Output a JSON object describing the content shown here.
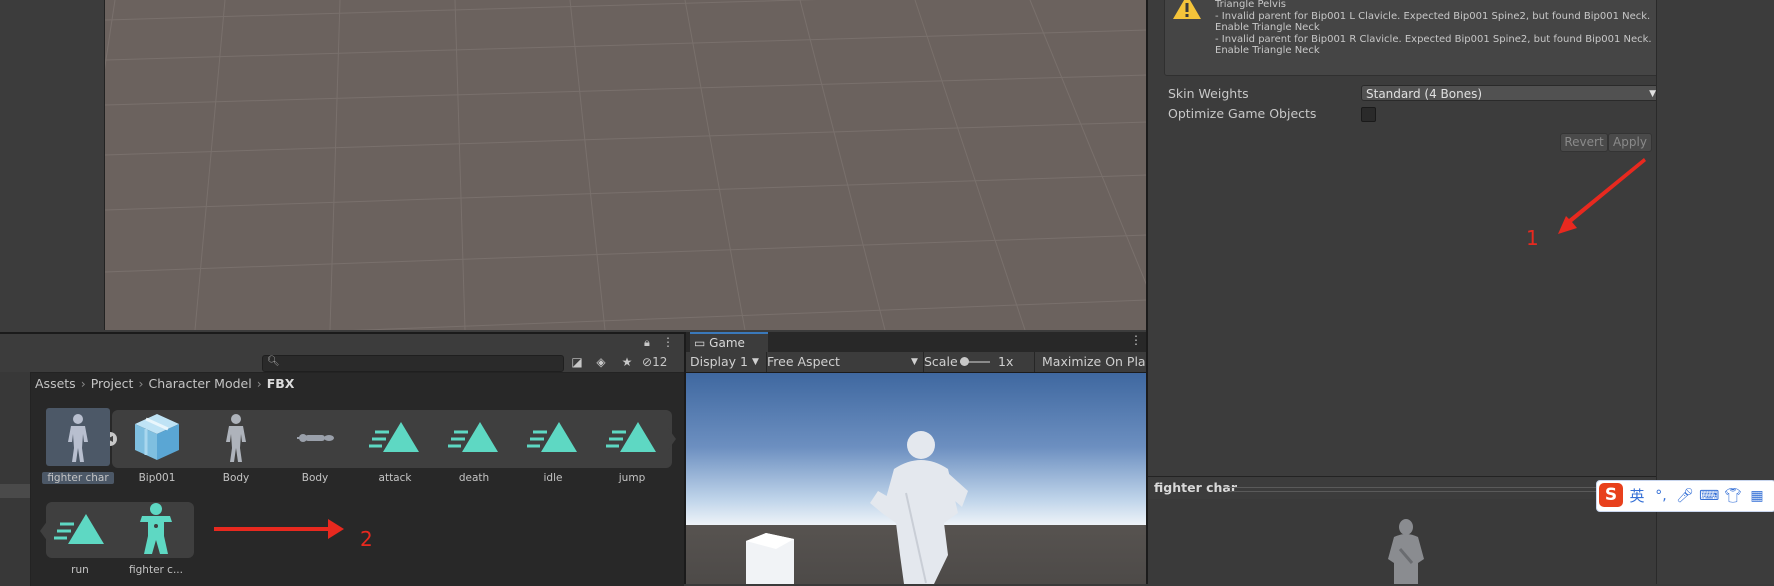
{
  "scene": {},
  "project": {
    "search_placeholder": "",
    "search_icon": "search-icon",
    "hidden_count": "12",
    "breadcrumb": [
      "Assets",
      "Project",
      "Character Model",
      "FBX"
    ],
    "assets_row1": [
      {
        "label": "fighter char",
        "icon": "character-model-icon",
        "selected": true
      },
      {
        "label": "Bip001",
        "icon": "prefab-cube-icon"
      },
      {
        "label": "Body",
        "icon": "character-model-icon"
      },
      {
        "label": "Body",
        "icon": "mesh-icon"
      },
      {
        "label": "attack",
        "icon": "animation-clip-icon"
      },
      {
        "label": "death",
        "icon": "animation-clip-icon"
      },
      {
        "label": "idle",
        "icon": "animation-clip-icon"
      },
      {
        "label": "jump",
        "icon": "animation-clip-icon"
      }
    ],
    "assets_row2": [
      {
        "label": "run",
        "icon": "animation-clip-icon"
      },
      {
        "label": "fighter c...",
        "icon": "avatar-icon"
      }
    ]
  },
  "game": {
    "tab_label": "Game",
    "display": "Display 1",
    "aspect": "Free Aspect",
    "scale_label": "Scale",
    "scale_value": "1x",
    "maximize": "Maximize On Pla"
  },
  "inspector": {
    "warning_text": "Triangle Pelvis\n- Invalid parent for Bip001 L Clavicle. Expected Bip001 Spine2, but found Bip001 Neck. Enable Triangle Neck\n- Invalid parent for Bip001 R Clavicle. Expected Bip001 Spine2, but found Bip001 Neck. Enable Triangle Neck",
    "skin_weights_label": "Skin Weights",
    "skin_weights_value": "Standard (4 Bones)",
    "optimize_label": "Optimize Game Objects",
    "optimize_checked": false,
    "revert_label": "Revert",
    "apply_label": "Apply",
    "preview_title": "fighter char"
  },
  "annotations": {
    "label_1": "1",
    "label_2": "2",
    "color": "#e8291f"
  },
  "ime": {
    "logo": "S",
    "lang": "英",
    "items": [
      "punctuation-icon",
      "microphone-icon",
      "keyboard-icon",
      "skin-shirt-icon",
      "grid-menu-icon"
    ]
  }
}
